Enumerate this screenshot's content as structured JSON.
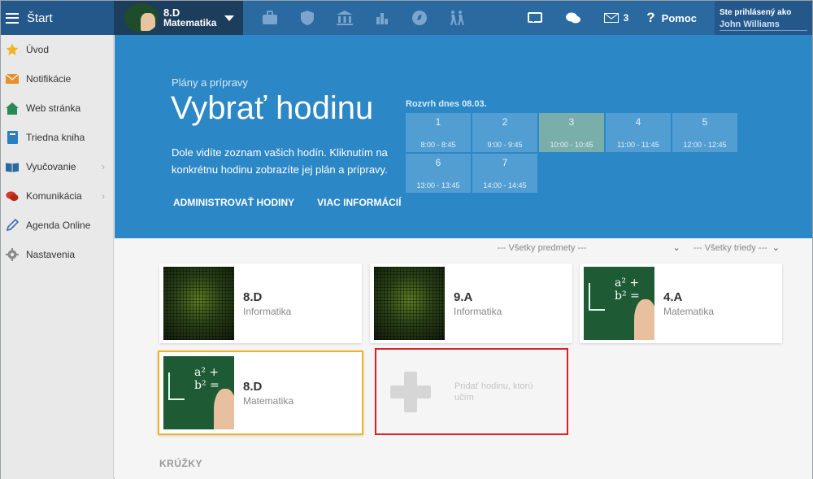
{
  "topbar": {
    "start_label": "Štart",
    "class_name": "8.D",
    "class_subject": "Matematika",
    "messages_count": "3",
    "help_label": "Pomoc",
    "user_label": "Ste prihlásený ako",
    "user_name": "John Williams"
  },
  "sidebar": {
    "items": [
      {
        "label": "Úvod",
        "icon": "star-icon"
      },
      {
        "label": "Notifikácie",
        "icon": "envelope-icon"
      },
      {
        "label": "Web stránka",
        "icon": "home-icon"
      },
      {
        "label": "Triedna kniha",
        "icon": "book-icon"
      },
      {
        "label": "Vyučovanie",
        "icon": "open-book-icon"
      },
      {
        "label": "Komunikácia",
        "icon": "chat-icon"
      },
      {
        "label": "Agenda Online",
        "icon": "pen-icon"
      },
      {
        "label": "Nastavenia",
        "icon": "gear-icon"
      }
    ]
  },
  "hero": {
    "subtitle": "Plány a prípravy",
    "title": "Vybrať hodinu",
    "description": "Dole vidíte zoznam vašich hodín. Kliknutím na konkrétnu hodinu zobrazíte jej plán a prípravy.",
    "link_admin": "ADMINISTROVAŤ HODINY",
    "link_more": "VIAC INFORMÁCIÍ",
    "schedule_title": "Rozvrh dnes 08.03.",
    "slots": [
      {
        "num": "1",
        "time": "8:00 - 8:45"
      },
      {
        "num": "2",
        "time": "9:00 - 9:45"
      },
      {
        "num": "3",
        "time": "10:00 - 10:45"
      },
      {
        "num": "4",
        "time": "11:00 - 11:45"
      },
      {
        "num": "5",
        "time": "12:00 - 12:45"
      },
      {
        "num": "6",
        "time": "13:00 - 13:45"
      },
      {
        "num": "7",
        "time": "14:00 - 14:45"
      }
    ]
  },
  "filters": {
    "subjects": "--- Všetky predmety ---",
    "classes": "--- Všetky triedy ---"
  },
  "lessons": [
    {
      "name": "8.D",
      "subject": "Informatika"
    },
    {
      "name": "9.A",
      "subject": "Informatika"
    },
    {
      "name": "4.A",
      "subject": "Matematika"
    },
    {
      "name": "8.D",
      "subject": "Matematika"
    }
  ],
  "add_lesson": "Pridať hodinu, ktorú učím",
  "section_clubs": "KRÚŽKY",
  "math_formula": "a² + b² ="
}
